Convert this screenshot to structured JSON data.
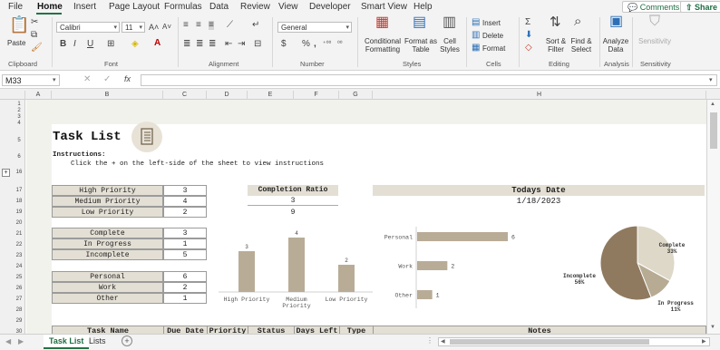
{
  "menu": {
    "items": [
      "File",
      "Home",
      "Insert",
      "Page Layout",
      "Formulas",
      "Data",
      "Review",
      "View",
      "Developer",
      "Smart View",
      "Help"
    ],
    "comments": "Comments",
    "share": "Share"
  },
  "ribbon": {
    "clipboard": {
      "paste": "Paste",
      "group": "Clipboard"
    },
    "font": {
      "name": "Calibri",
      "size": "11",
      "group": "Font",
      "bold": "B",
      "italic": "I",
      "underline": "U"
    },
    "alignment": {
      "group": "Alignment"
    },
    "number": {
      "format": "General",
      "group": "Number"
    },
    "styles": {
      "conditional": "Conditional Formatting",
      "table": "Format as Table",
      "cell": "Cell Styles",
      "group": "Styles"
    },
    "cells": {
      "insert": "Insert",
      "delete": "Delete",
      "format": "Format",
      "group": "Cells"
    },
    "editing": {
      "sort": "Sort & Filter",
      "find": "Find & Select",
      "group": "Editing"
    },
    "analysis": {
      "analyze": "Analyze Data",
      "group": "Analysis"
    },
    "sensitivity": {
      "label": "Sensitivity",
      "group": "Sensitivity"
    }
  },
  "formula_bar": {
    "name_box": "M33",
    "fx": "fx",
    "value": ""
  },
  "columns": [
    "A",
    "B",
    "C",
    "D",
    "E",
    "F",
    "G",
    "H"
  ],
  "rows": [
    "1",
    "2",
    "3",
    "4",
    "5",
    "6",
    "16",
    "17",
    "18",
    "19",
    "20",
    "21",
    "22",
    "23",
    "24",
    "25",
    "26",
    "27",
    "28",
    "29",
    "30",
    "31"
  ],
  "sheet": {
    "title": "Task List",
    "instructions_label": "Instructions:",
    "instructions_text": "Click the + on the left-side of the sheet to view instructions",
    "priority": [
      {
        "label": "High Priority",
        "value": "3"
      },
      {
        "label": "Medium Priority",
        "value": "4"
      },
      {
        "label": "Low Priority",
        "value": "2"
      }
    ],
    "status": [
      {
        "label": "Complete",
        "value": "3"
      },
      {
        "label": "In Progress",
        "value": "1"
      },
      {
        "label": "Incomplete",
        "value": "5"
      }
    ],
    "category": [
      {
        "label": "Personal",
        "value": "6"
      },
      {
        "label": "Work",
        "value": "2"
      },
      {
        "label": "Other",
        "value": "1"
      }
    ],
    "completion_ratio": {
      "title": "Completion Ratio",
      "complete": "3",
      "total": "9"
    },
    "todays_date": {
      "title": "Todays Date",
      "value": "1/18/2023"
    },
    "table_headers": [
      "Task Name",
      "Due Date",
      "Priority",
      "Status",
      "Days Left",
      "Type",
      "Notes"
    ]
  },
  "chart_data": [
    {
      "type": "bar",
      "categories": [
        "High Priority",
        "Medium Priority",
        "Low Priority"
      ],
      "values": [
        3,
        4,
        2
      ],
      "color": "#b9ac97"
    },
    {
      "type": "bar",
      "orientation": "horizontal",
      "categories": [
        "Personal",
        "Work",
        "Other"
      ],
      "values": [
        6,
        2,
        1
      ],
      "color": "#b9ac97"
    },
    {
      "type": "pie",
      "categories": [
        "Complete",
        "In Progress",
        "Incomplete"
      ],
      "values": [
        33,
        11,
        56
      ],
      "labels": [
        "Complete\n33%",
        "In Progress\n11%",
        "Incomplete\n56%"
      ],
      "colors": [
        "#ddd8c8",
        "#b7ab94",
        "#8f7a60"
      ]
    }
  ],
  "tabs": {
    "active": "Task List",
    "other": "Lists"
  },
  "colors": {
    "accent": "#217346",
    "header_fill": "#e3dfd4"
  }
}
